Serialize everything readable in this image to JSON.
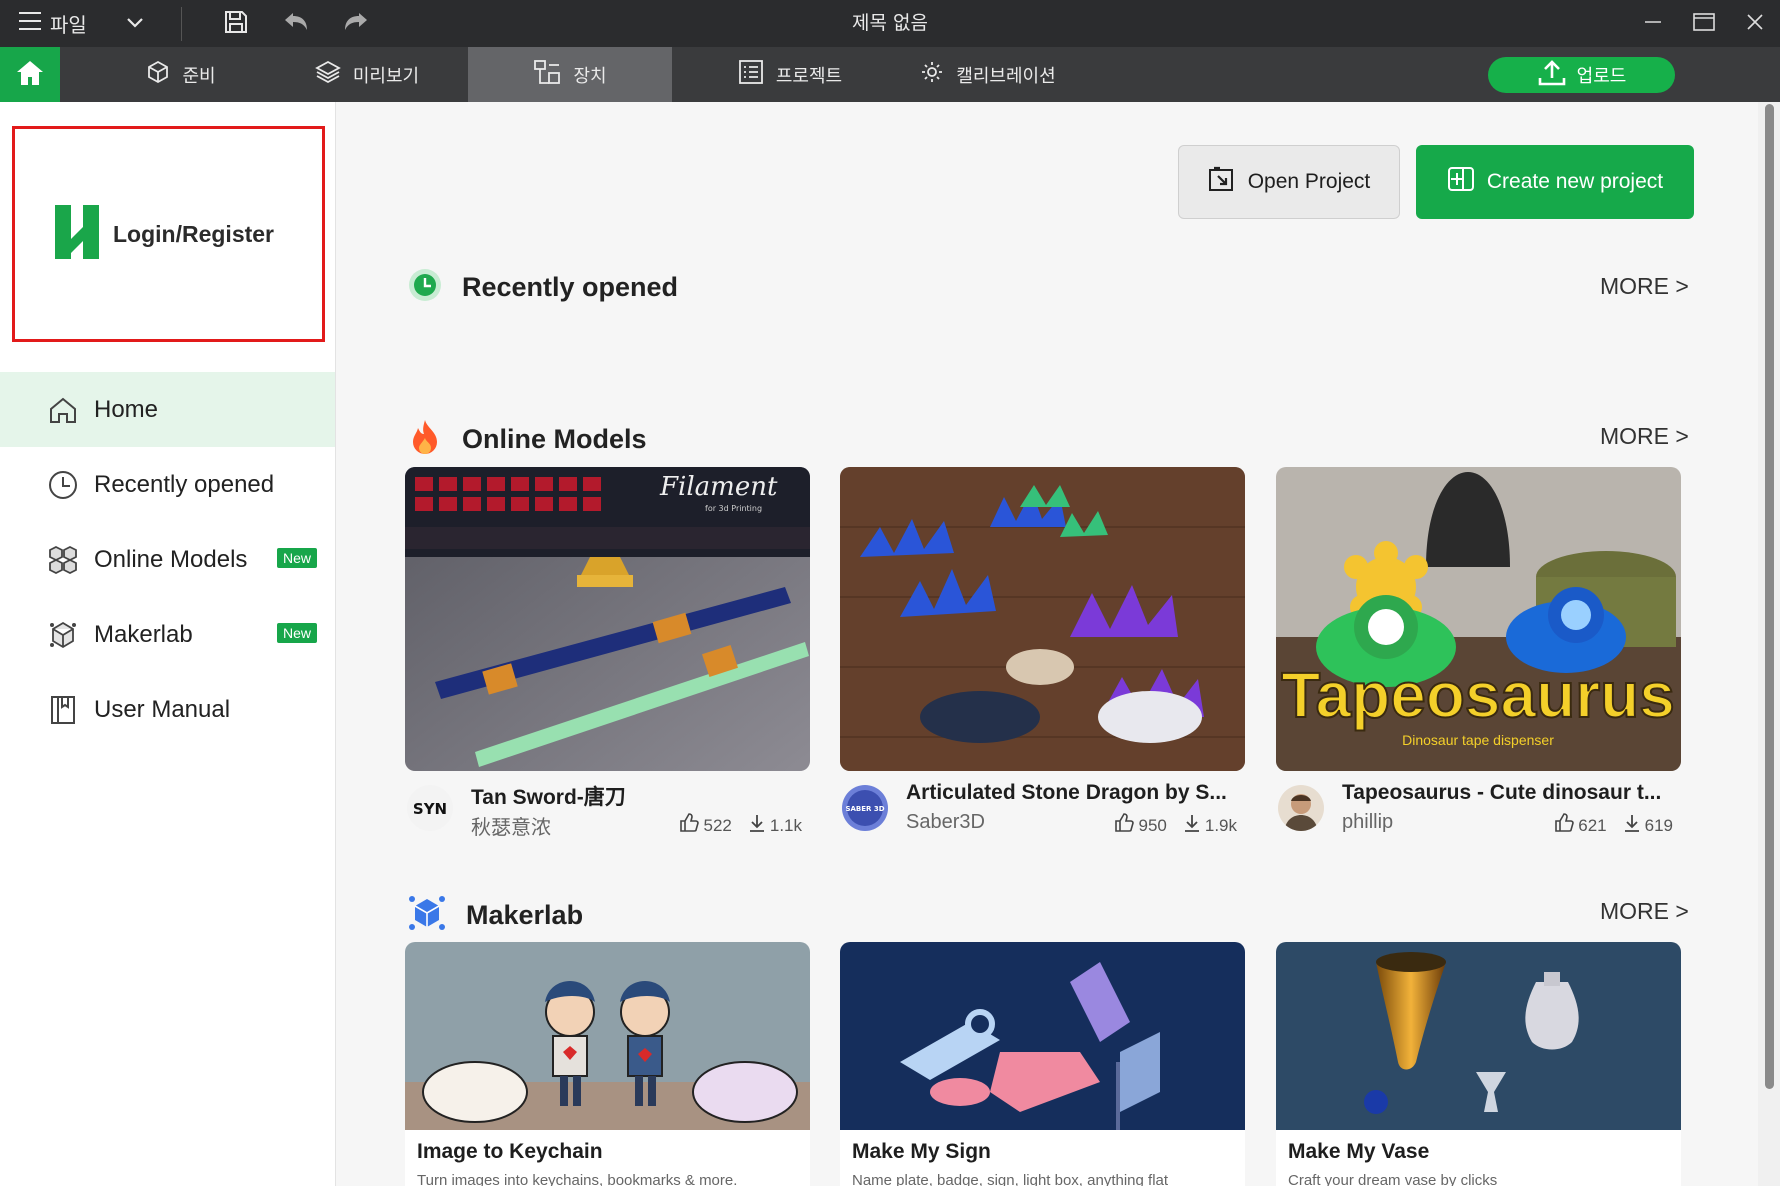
{
  "window": {
    "title": "제목 없음",
    "menu_label": "파일"
  },
  "toolbar": {
    "tabs": [
      {
        "label": "준비",
        "icon": "cube-icon"
      },
      {
        "label": "미리보기",
        "icon": "layers-icon"
      },
      {
        "label": "장치",
        "icon": "device-icon",
        "active": true
      },
      {
        "label": "프로젝트",
        "icon": "list-icon"
      },
      {
        "label": "캘리브레이션",
        "icon": "calibration-gear-icon"
      }
    ],
    "upload_label": "업로드",
    "accent": "#16b04a"
  },
  "sidebar": {
    "login_label": "Login/Register",
    "items": [
      {
        "label": "Home",
        "icon": "home-icon",
        "active": true
      },
      {
        "label": "Recently opened",
        "icon": "clock-icon"
      },
      {
        "label": "Online Models",
        "icon": "cubes-icon",
        "badge": "New"
      },
      {
        "label": "Makerlab",
        "icon": "makerlab-icon",
        "badge": "New"
      },
      {
        "label": "User Manual",
        "icon": "book-icon"
      }
    ]
  },
  "main": {
    "open_project_label": "Open Project",
    "create_project_label": "Create new project",
    "sections": {
      "recent": {
        "title": "Recently opened",
        "more": "MORE >"
      },
      "online": {
        "title": "Online Models",
        "more": "MORE >"
      },
      "makerlab": {
        "title": "Makerlab",
        "more": "MORE >"
      }
    },
    "models": [
      {
        "title": "Tan Sword-唐刀",
        "author": "秋瑟意浓",
        "likes": "522",
        "downloads": "1.1k"
      },
      {
        "title": "Articulated Stone Dragon by S...",
        "author": "Saber3D",
        "likes": "950",
        "downloads": "1.9k"
      },
      {
        "title": "Tapeosaurus - Cute dinosaur t...",
        "author": "phillip",
        "likes": "621",
        "downloads": "619"
      }
    ],
    "model_thumb_text": {
      "filament": "Filament",
      "filament_sub": "for 3d Printing",
      "tapeosaurus": "Tapeosaurus",
      "tapeosaurus_sub": "Dinosaur tape dispenser",
      "avatar_syn": "SYN",
      "avatar_saber": "SABER 3D"
    },
    "makerlab": [
      {
        "title": "Image to Keychain",
        "desc": "Turn images into keychains, bookmarks & more."
      },
      {
        "title": "Make My Sign",
        "desc": "Name plate, badge, sign, light box, anything flat"
      },
      {
        "title": "Make My Vase",
        "desc": "Craft your dream vase by clicks"
      }
    ]
  }
}
